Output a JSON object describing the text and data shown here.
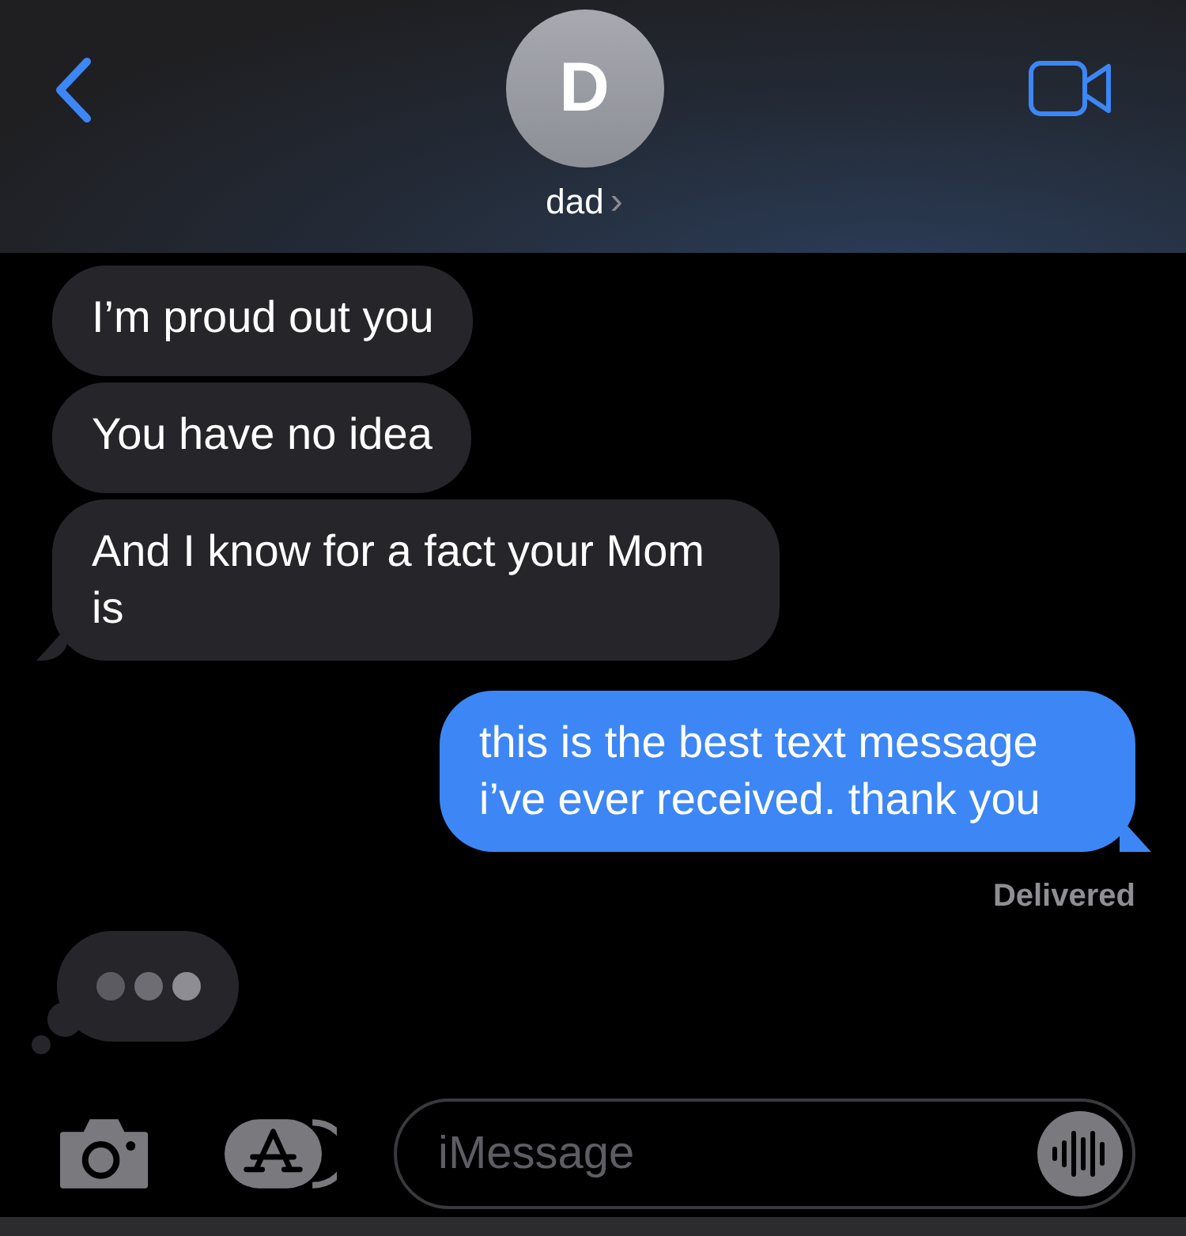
{
  "header": {
    "avatar_initial": "D",
    "contact_name": "dad",
    "chevron": "›"
  },
  "messages": [
    {
      "kind": "incoming",
      "text": "I’m proud out you",
      "tail": false
    },
    {
      "kind": "incoming",
      "text": "You have no idea",
      "tail": false
    },
    {
      "kind": "incoming",
      "text": "And I know for a fact your Mom is",
      "tail": true
    },
    {
      "kind": "outgoing",
      "text": "this is the best text message i’ve ever received. thank you",
      "tail": true
    }
  ],
  "status": "Delivered",
  "typing_indicator": true,
  "composer": {
    "placeholder": "iMessage"
  }
}
